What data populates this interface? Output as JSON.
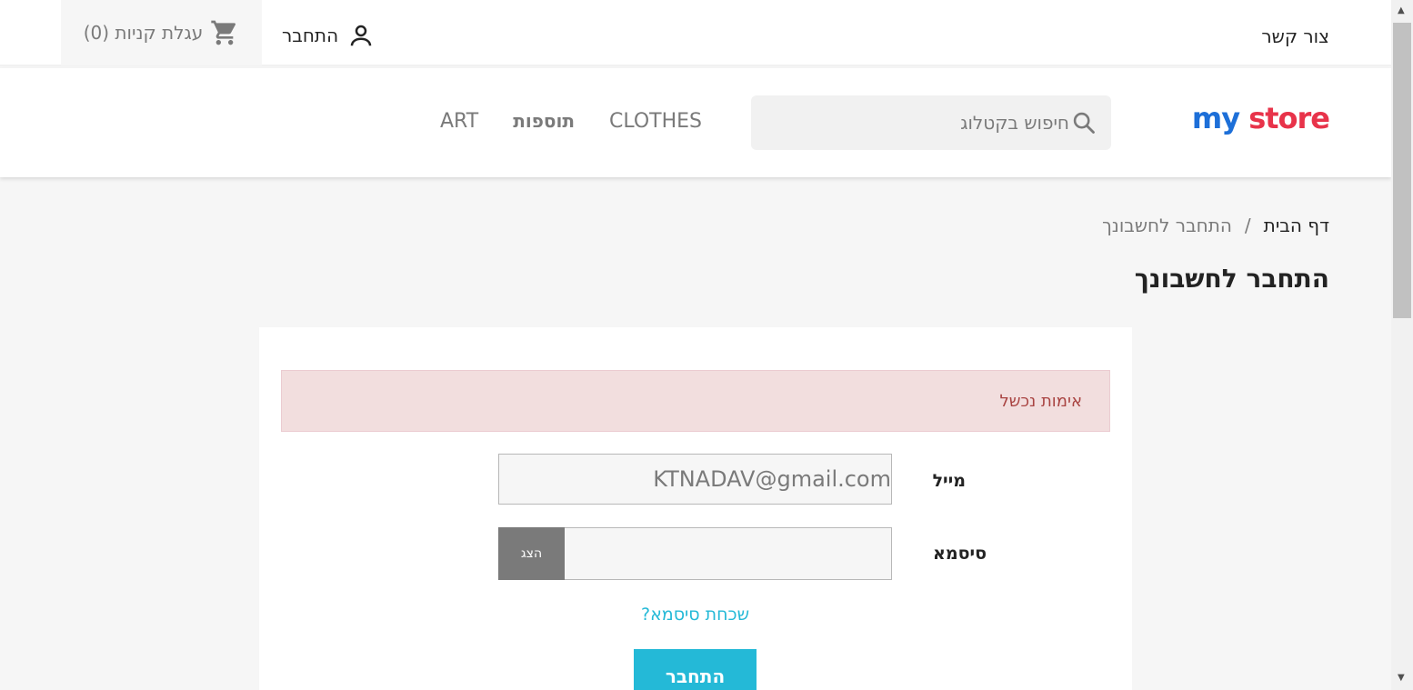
{
  "topbar": {
    "contact": "צור קשר",
    "signin": "התחבר",
    "cart": "עגלת קניות (0)"
  },
  "header": {
    "logo": {
      "my": "my",
      "store": "store"
    },
    "search_placeholder": "חיפוש בקטלוג",
    "nav": [
      "ART",
      "תוספות",
      "CLOTHES"
    ]
  },
  "breadcrumb": {
    "home": "דף הבית",
    "separator": "/",
    "current": "התחבר לחשבונך"
  },
  "page_title": "התחבר לחשבונך",
  "form": {
    "alert": "אימות נכשל",
    "email_label": "מייל",
    "email_value": "KTNADAV@gmail.com",
    "password_label": "סיסמא",
    "show_button": "הצג",
    "forgot_link": "שכחת סיסמא?",
    "submit": "התחבר"
  },
  "colors": {
    "accent": "#24b9d7",
    "alert_bg": "#f2dede",
    "alert_text": "#a94442"
  }
}
